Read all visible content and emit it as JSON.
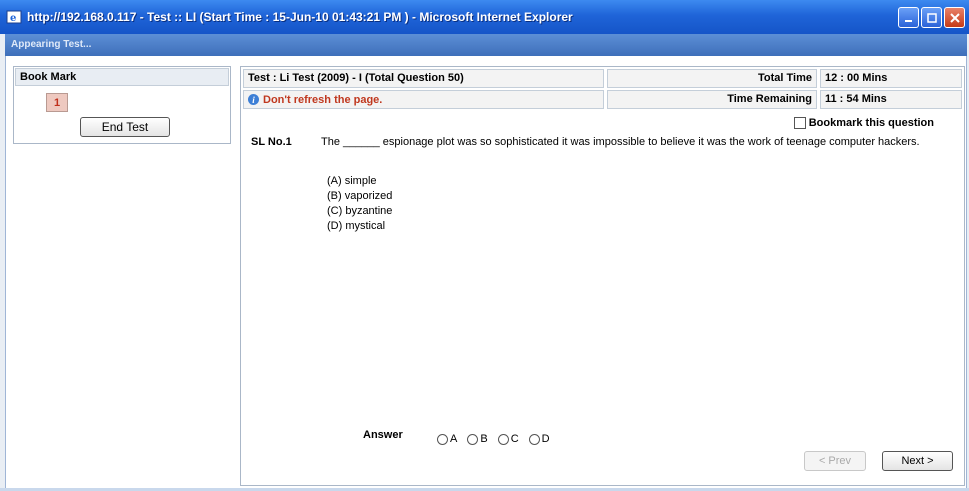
{
  "window": {
    "title": "http://192.168.0.117 - Test :: LI (Start Time : 15-Jun-10 01:43:21 PM ) - Microsoft Internet Explorer",
    "subtitle": "Appearing Test...",
    "controls": [
      "minimize",
      "maximize",
      "close"
    ]
  },
  "bookmark_panel": {
    "header": "Book Mark",
    "question_buttons": [
      "1"
    ],
    "end_test_label": "End Test"
  },
  "test_header": {
    "name": "Test : Li Test (2009) - I (Total Question 50)",
    "warning": "Don't refresh the page.",
    "total_time_label": "Total Time",
    "total_time_value": "12 : 00 Mins",
    "remaining_label": "Time Remaining",
    "remaining_value": "11 : 54 Mins"
  },
  "question": {
    "bookmark_label": "Bookmark this question",
    "sl_no": "SL No.1",
    "text": "The ______ espionage plot was so sophisticated it was impossible to believe it was the work of teenage computer hackers.",
    "options": [
      "(A)  simple",
      "(B)  vaporized",
      "(C)  byzantine",
      "(D)  mystical"
    ]
  },
  "answer": {
    "label": "Answer",
    "choices": [
      "A",
      "B",
      "C",
      "D"
    ],
    "selected": null
  },
  "nav": {
    "prev_label": "< Prev",
    "next_label": "Next >"
  },
  "colors": {
    "titlebar": "#1f64d8",
    "warning": "#c0381f",
    "question_button": "#eec9c0"
  }
}
